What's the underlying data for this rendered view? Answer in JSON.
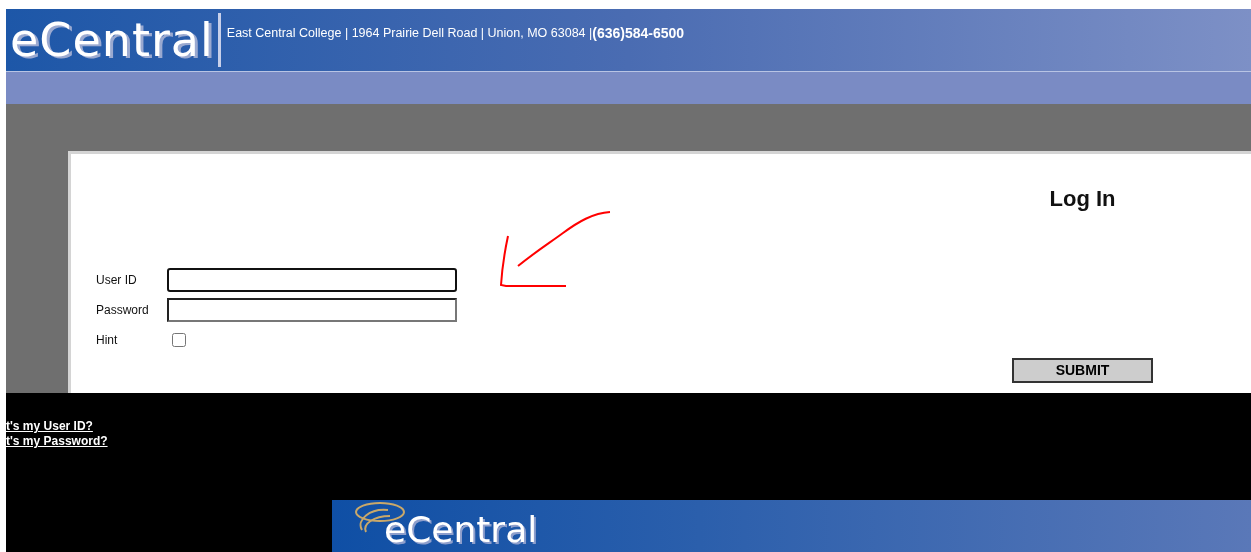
{
  "header": {
    "logo": "eCentral",
    "address": "East Central College | 1964 Prairie Dell Road | Union, MO 63084 |",
    "phone": "(636)584-6500"
  },
  "login": {
    "title": "Log In",
    "fields": [
      {
        "label": "User ID",
        "kind": "text",
        "focused": true
      },
      {
        "label": "Password",
        "kind": "password",
        "focused": false
      },
      {
        "label": "Hint",
        "kind": "checkbox",
        "checked": false
      }
    ],
    "submit": "SUBMIT",
    "annotation": {
      "kind": "arrow"
    }
  },
  "links": [
    "t's my User ID?",
    "t's my Password?"
  ],
  "footer": {
    "logo": "eCentral"
  }
}
